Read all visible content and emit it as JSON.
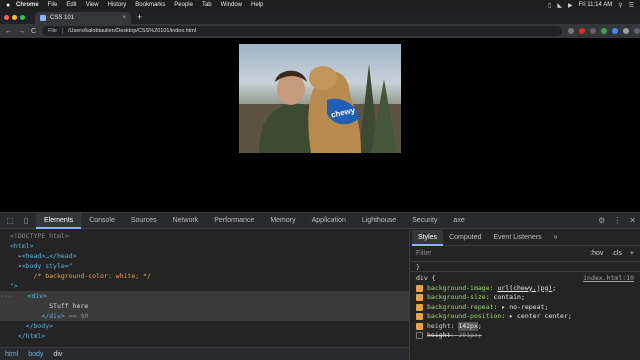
{
  "menubar": {
    "apple": "",
    "items": [
      "Chrome",
      "File",
      "Edit",
      "View",
      "History",
      "Bookmarks",
      "People",
      "Tab",
      "Window",
      "Help"
    ],
    "clock": "Fri 11:14 AM"
  },
  "tab": {
    "title": "CSS 101",
    "close": "×"
  },
  "newtab": "+",
  "toolbar": {
    "back": "←",
    "forward": "→",
    "reload": "C",
    "scheme": "File",
    "url": "/Users/kalobtaulien/Desktop/CSS%20101/index.html"
  },
  "image": {
    "bandana_text": "chewy"
  },
  "devtools": {
    "tabs": [
      "Elements",
      "Console",
      "Sources",
      "Network",
      "Performance",
      "Memory",
      "Application",
      "Lighthouse",
      "Security",
      "axe"
    ],
    "active_tab": "Elements",
    "dom": {
      "doctype": "<!DOCTYPE html>",
      "html_open": "<html>",
      "head": "<head>…</head>",
      "body_open": "<body style=\"",
      "comment": "/* background-color: white; */",
      "body_close_quote": "\">",
      "ellipsis": "···",
      "div_open": "<div>",
      "div_text": "STuff here",
      "div_close": "</div>",
      "div_marker": "== $0",
      "body_close": "</body>",
      "html_close": "</html>"
    },
    "breadcrumbs": [
      "html",
      "body",
      "div"
    ],
    "styles": {
      "tabs": [
        "Styles",
        "Computed",
        "Event Listeners",
        "»"
      ],
      "active_tab": "Styles",
      "filter_placeholder": "Filter",
      "hov": ":hov",
      "cls": ".cls",
      "add": "+",
      "prev_rule_close": "}",
      "selector": "div {",
      "source": "index.html:10",
      "declarations": [
        {
          "prop": "background-image",
          "value": "url(chewy.jpg)",
          "enabled": true,
          "struck": false
        },
        {
          "prop": "background-size",
          "value": "contain",
          "enabled": true,
          "struck": false
        },
        {
          "prop": "background-repeat",
          "value": "no-repeat",
          "enabled": true,
          "struck": false
        },
        {
          "prop": "background-position",
          "value": "center center",
          "enabled": true,
          "struck": false
        },
        {
          "prop": "height",
          "value": "142px",
          "enabled": true,
          "struck": false
        },
        {
          "prop": "height",
          "value": "201px",
          "enabled": false,
          "struck": true
        }
      ]
    }
  }
}
